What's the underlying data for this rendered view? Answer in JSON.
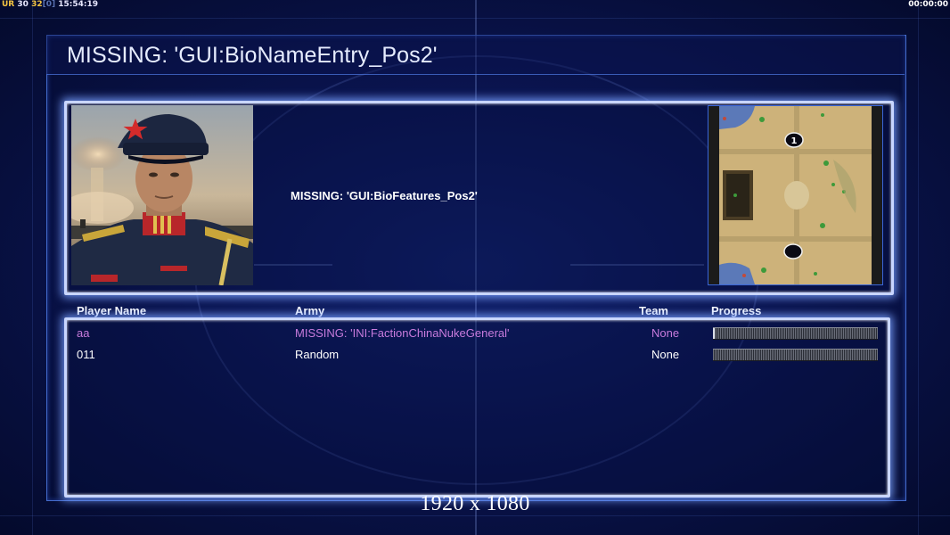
{
  "hud": {
    "ur_label": "UR",
    "value_a": "30",
    "value_b": "32",
    "value_c": "[0]",
    "clock": "15:54:19",
    "timer": "00:00:00"
  },
  "title": "MISSING: 'GUI:BioNameEntry_Pos2'",
  "bio_features": "MISSING: 'GUI:BioFeatures_Pos2'",
  "table": {
    "headers": {
      "player": "Player Name",
      "army": "Army",
      "team": "Team",
      "progress": "Progress"
    },
    "rows": [
      {
        "player": "aa",
        "army": "MISSING: 'INI:FactionChinaNukeGeneral'",
        "team": "None",
        "progress": 0.01,
        "color": "#c77bdc"
      },
      {
        "player": "011",
        "army": "Random",
        "team": "None",
        "progress": 0.0,
        "color": "#ffffff"
      }
    ]
  },
  "minimap": {
    "start_positions": [
      "1",
      ""
    ]
  },
  "resolution": "1920 x 1080",
  "colors": {
    "accent": "#c9d6ff",
    "player_highlight": "#c77bdc",
    "background": "#0a1450"
  }
}
